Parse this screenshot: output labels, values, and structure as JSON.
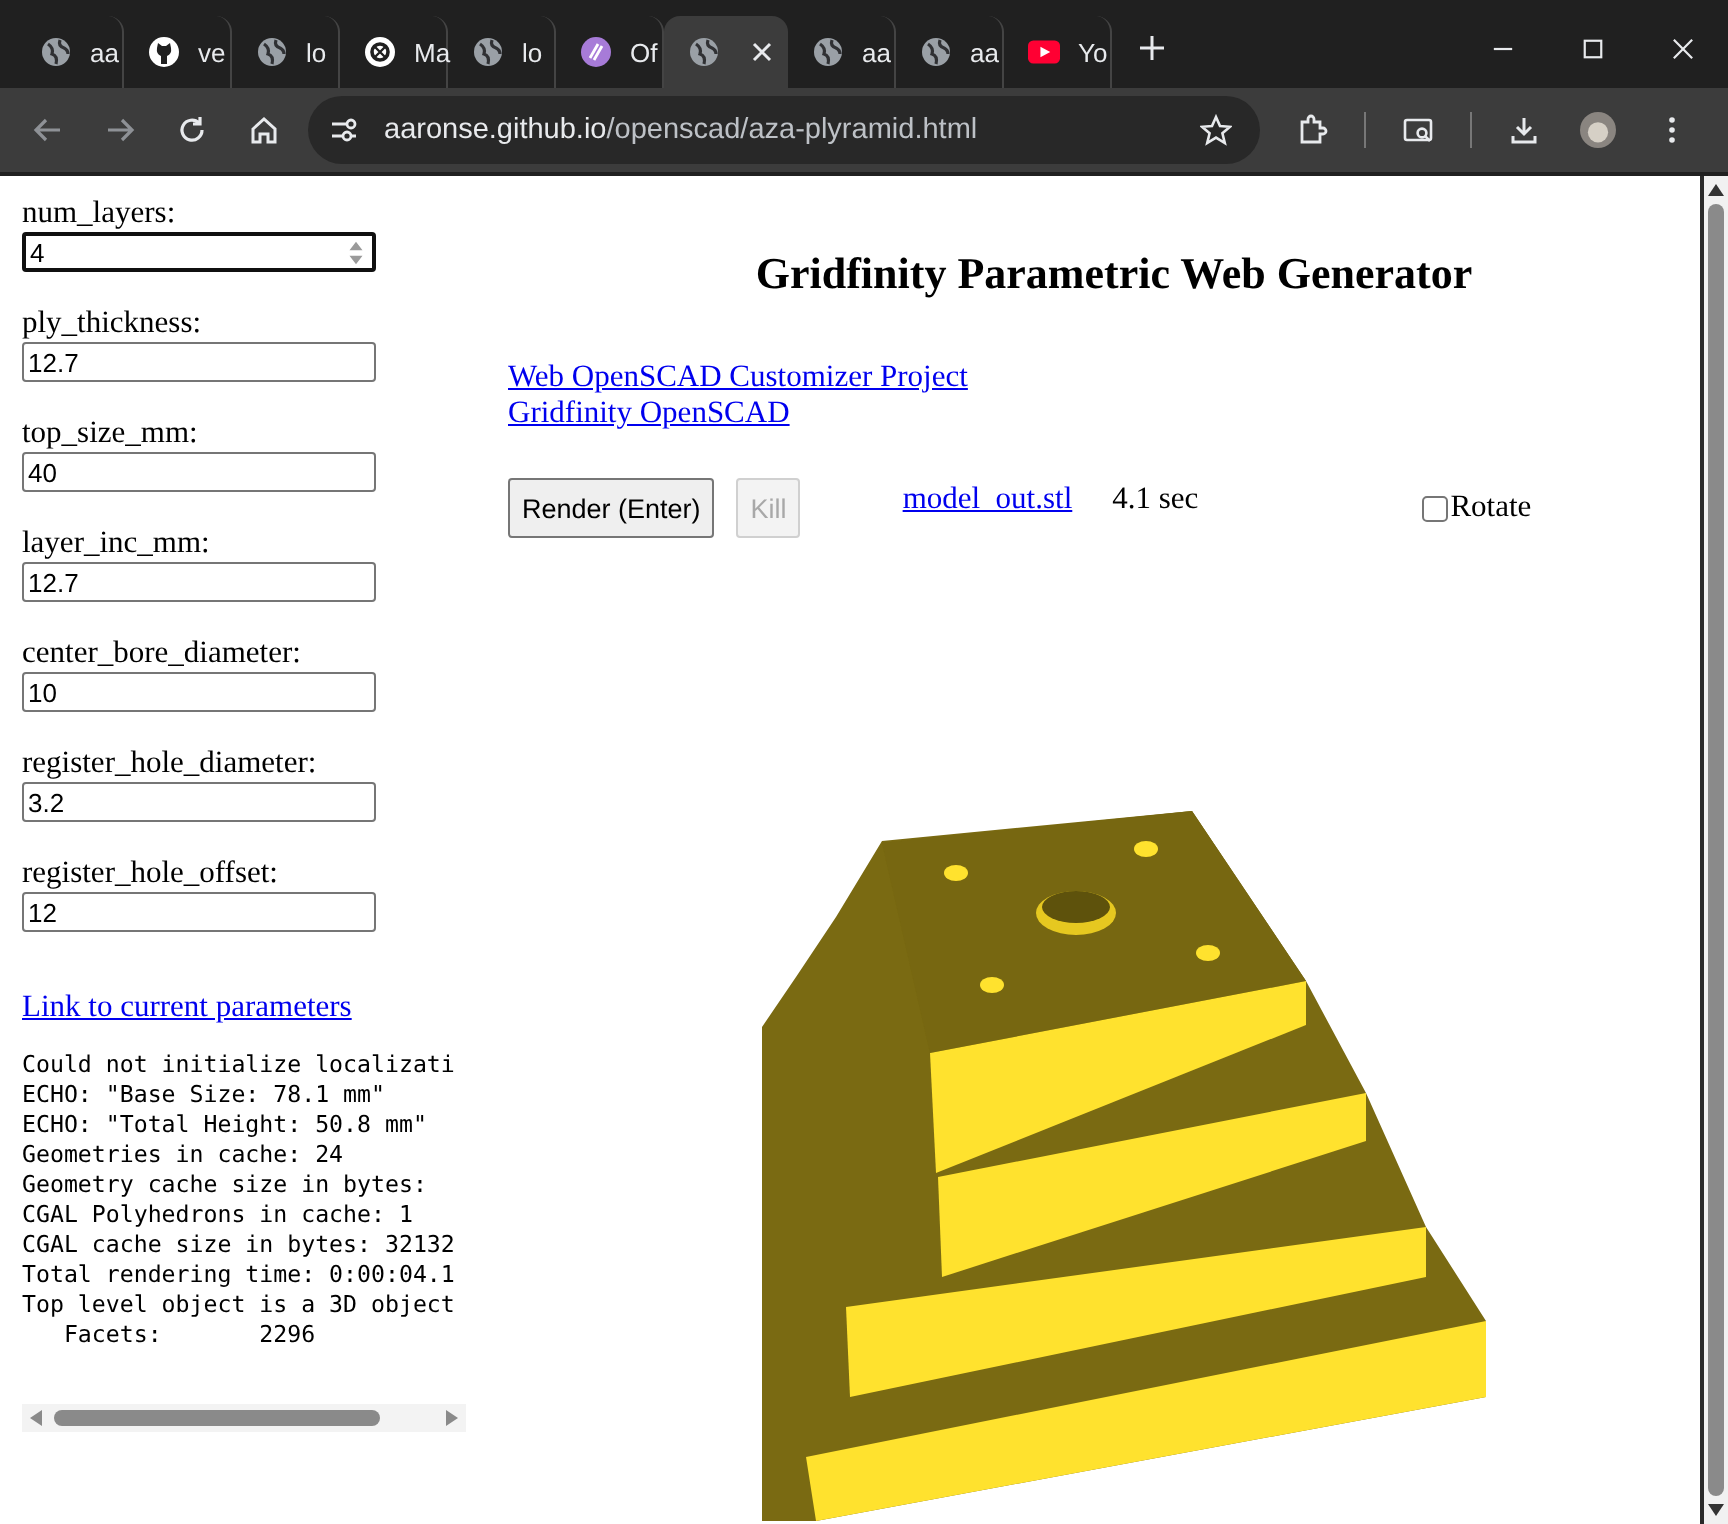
{
  "browser": {
    "tabs": [
      {
        "label": "aa",
        "kind": "globe",
        "selected": false
      },
      {
        "label": "ve",
        "kind": "github",
        "selected": false
      },
      {
        "label": "lo",
        "kind": "globe",
        "selected": false
      },
      {
        "label": "Ma",
        "kind": "knot",
        "selected": false
      },
      {
        "label": "lo",
        "kind": "globe",
        "selected": false
      },
      {
        "label": "Of",
        "kind": "purple",
        "selected": false
      },
      {
        "kind": "globe",
        "selected": true
      },
      {
        "label": "aa",
        "kind": "globe",
        "selected": false
      },
      {
        "label": "aa",
        "kind": "globe",
        "selected": false
      },
      {
        "label": "Yo",
        "kind": "play",
        "selected": false
      }
    ],
    "address": {
      "host": "aaronse.github.io",
      "path": "/openscad/aza-plyramid.html"
    }
  },
  "parameters": [
    {
      "label": "num_layers:",
      "value": "4",
      "kind": "number",
      "focused": true
    },
    {
      "label": "ply_thickness:",
      "value": "12.7",
      "kind": "text",
      "focused": false
    },
    {
      "label": "top_size_mm:",
      "value": "40",
      "kind": "text",
      "focused": false
    },
    {
      "label": "layer_inc_mm:",
      "value": "12.7",
      "kind": "text",
      "focused": false
    },
    {
      "label": "center_bore_diameter:",
      "value": "10",
      "kind": "text",
      "focused": false
    },
    {
      "label": "register_hole_diameter:",
      "value": "3.2",
      "kind": "text",
      "focused": false
    },
    {
      "label": "register_hole_offset:",
      "value": "12",
      "kind": "text",
      "focused": false
    }
  ],
  "params_link": "Link to current parameters",
  "console_lines": [
    "Could not initialize localizati",
    "ECHO: \"Base Size: 78.1 mm\"",
    "ECHO: \"Total Height: 50.8 mm\"",
    "Geometries in cache: 24",
    "Geometry cache size in bytes: ",
    "CGAL Polyhedrons in cache: 1",
    "CGAL cache size in bytes: 32132",
    "Total rendering time: 0:00:04.1",
    "Top level object is a 3D object",
    "   Facets:       2296"
  ],
  "title": "Gridfinity Parametric Web Generator",
  "links": [
    "Web OpenSCAD Customizer Project",
    "Gridfinity OpenSCAD"
  ],
  "render_button": {
    "label": "Render (Enter)",
    "disabled": false
  },
  "kill_button": {
    "label": "Kill",
    "disabled": true
  },
  "output_link": "model_out.stl",
  "render_time": "4.1 sec",
  "rotate": {
    "label": "Rotate",
    "checked": false
  }
}
